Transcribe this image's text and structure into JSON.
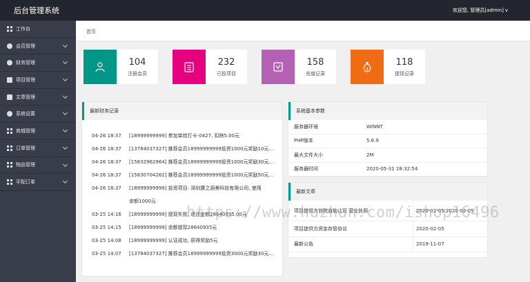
{
  "topbar": {
    "title": "后台管理系统",
    "user_greeting": "欢迎您, 管理员[admin]",
    "chevron": "v"
  },
  "sidebar": {
    "items": [
      {
        "label": "工作台",
        "icon": "grid-icon",
        "has_chevron": false
      },
      {
        "label": "会员管理",
        "icon": "circle-icon",
        "has_chevron": true
      },
      {
        "label": "财务管理",
        "icon": "circle-icon",
        "has_chevron": true
      },
      {
        "label": "项目管理",
        "icon": "document-icon",
        "has_chevron": true
      },
      {
        "label": "文章管理",
        "icon": "document-icon",
        "has_chevron": true
      },
      {
        "label": "系统设置",
        "icon": "gear-icon",
        "has_chevron": true
      },
      {
        "label": "商城管理",
        "icon": "grid-icon",
        "has_chevron": true
      },
      {
        "label": "订单管理",
        "icon": "grid-icon",
        "has_chevron": true
      },
      {
        "label": "物品管理",
        "icon": "grid-icon",
        "has_chevron": true
      },
      {
        "label": "平配订单",
        "icon": "grid-icon",
        "has_chevron": true
      }
    ]
  },
  "breadcrumb": {
    "label": "首页"
  },
  "stats": [
    {
      "value": "104",
      "label": "注册会员",
      "color": "#009688",
      "icon": "user-icon"
    },
    {
      "value": "232",
      "label": "已投项目",
      "color": "#e4007f",
      "icon": "clipboard-icon"
    },
    {
      "value": "158",
      "label": "充值记录",
      "color": "#b461b4",
      "icon": "recharge-icon"
    },
    {
      "value": "118",
      "label": "提现记录",
      "color": "#ee6d14",
      "icon": "money-bag-icon"
    }
  ],
  "finance": {
    "title": "最新财务记录",
    "rows": [
      {
        "time": "04-26 18:37",
        "text": "[18999999999] 参加单挂打卡-0427, 扣除5.00元"
      },
      {
        "time": "04-26 18:37",
        "text": "[13784037327] 推荐会员18999999999投资1000元奖励10元..."
      },
      {
        "time": "04-26 18:37",
        "text": "[15832962964] 推荐会员18999999999投资1000元奖励30元..."
      },
      {
        "time": "04-26 18:37",
        "text": "[15830704262] 推荐会员18999999999投资1000元奖励50元..."
      },
      {
        "time": "04-26 18:37",
        "text": "[18999999999] 投资项目: 深圳康之源美科技有限公司, 使用"
      },
      {
        "time": "",
        "text": "余额1000元"
      },
      {
        "time": "03-25 14:16",
        "text": "[18999999999] 提现失败, 退还金额28640935.00元"
      },
      {
        "time": "03-25 14:15",
        "text": "[18999999999] 余额提现28640935元"
      },
      {
        "time": "03-25 14:08",
        "text": "[18999999999] 认证成功, 获得奖励5元"
      },
      {
        "time": "03-25 14:07",
        "text": "[13784037327] 推荐会员18999999999投资3000元奖励30元..."
      }
    ]
  },
  "system": {
    "title": "系统基本参数",
    "rows": [
      {
        "key": "服务器环境",
        "value": "WINNT"
      },
      {
        "key": "PHP版本",
        "value": "5.6.9"
      },
      {
        "key": "最大文件大小",
        "value": "2M"
      },
      {
        "key": "服务器时间",
        "value": "2020-05-31 18:32:54"
      }
    ]
  },
  "articles": {
    "title": "最新文章",
    "rows": [
      {
        "key": "项目提供方协院自助认可 营业执照",
        "value": "2020-02-05 2020-02-05"
      },
      {
        "key": "项目提供方资金存管协议",
        "value": "2020-02-05"
      },
      {
        "key": "最新公告",
        "value": "2019-11-07"
      }
    ]
  },
  "watermark": "https://www.huzhan.com/ishop16496"
}
